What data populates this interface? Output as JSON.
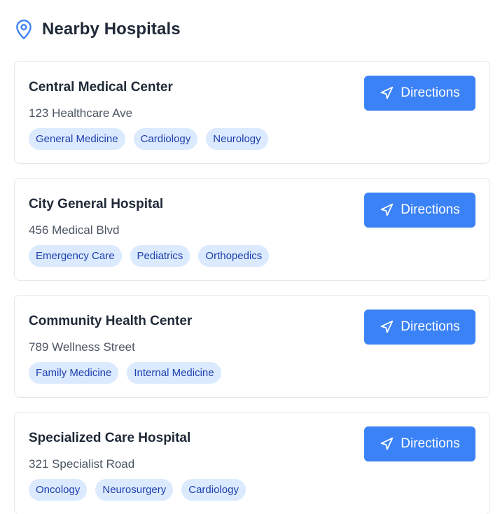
{
  "header": {
    "title": "Nearby Hospitals",
    "icon": "map-pin-icon",
    "icon_color": "#3b82f6"
  },
  "colors": {
    "accent": "#3b82f6",
    "tag_bg": "#dbeafe",
    "tag_text": "#1e40af",
    "card_border": "#e5e7eb"
  },
  "hospitals": [
    {
      "name": "Central Medical Center",
      "address": "123 Healthcare Ave",
      "tags": [
        "General Medicine",
        "Cardiology",
        "Neurology"
      ],
      "button_label": "Directions",
      "button_icon": "navigation-arrow-icon"
    },
    {
      "name": "City General Hospital",
      "address": "456 Medical Blvd",
      "tags": [
        "Emergency Care",
        "Pediatrics",
        "Orthopedics"
      ],
      "button_label": "Directions",
      "button_icon": "navigation-arrow-icon"
    },
    {
      "name": "Community Health Center",
      "address": "789 Wellness Street",
      "tags": [
        "Family Medicine",
        "Internal Medicine"
      ],
      "button_label": "Directions",
      "button_icon": "navigation-arrow-icon"
    },
    {
      "name": "Specialized Care Hospital",
      "address": "321 Specialist Road",
      "tags": [
        "Oncology",
        "Neurosurgery",
        "Cardiology"
      ],
      "button_label": "Directions",
      "button_icon": "navigation-arrow-icon"
    }
  ]
}
